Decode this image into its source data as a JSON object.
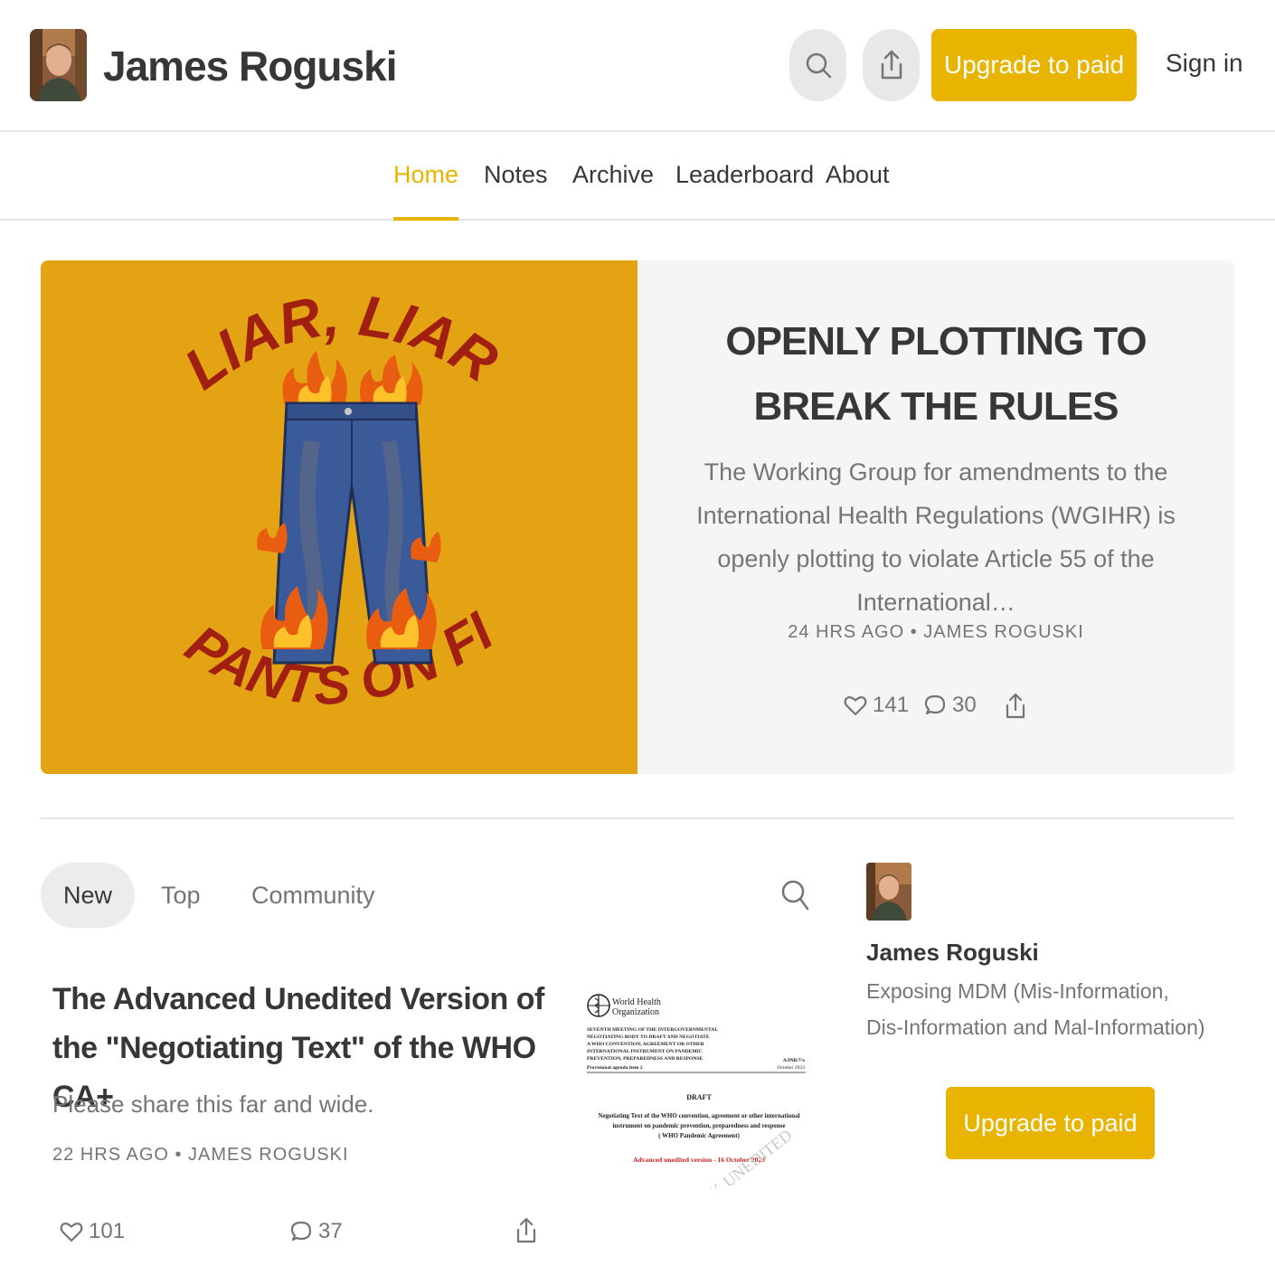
{
  "header": {
    "publication_title": "James Roguski",
    "upgrade_label": "Upgrade to paid",
    "signin_label": "Sign in",
    "search_icon": "search-icon",
    "share_icon": "share-icon"
  },
  "nav": {
    "items": [
      {
        "label": "Home",
        "active": true
      },
      {
        "label": "Notes",
        "active": false
      },
      {
        "label": "Archive",
        "active": false
      },
      {
        "label": "Leaderboard",
        "active": false
      },
      {
        "label": "About",
        "active": false
      }
    ]
  },
  "hero": {
    "image_text_top": "LIAR, LIAR,",
    "image_text_bottom": "PANTS ON FIRE",
    "title": "OPENLY PLOTTING TO BREAK THE RULES",
    "subtitle": "The Working Group for amendments to the International Health Regulations (WGIHR) is openly plotting to violate Article 55 of the International…",
    "meta": "24 HRS AGO • JAMES ROGUSKI",
    "likes": "141",
    "comments": "30"
  },
  "tabs": {
    "items": [
      {
        "label": "New",
        "active": true
      },
      {
        "label": "Top",
        "active": false
      },
      {
        "label": "Community",
        "active": false
      }
    ]
  },
  "post": {
    "title": "The Advanced Unedited Version of the \"Negotiating Text\" of the WHO CA+",
    "subtitle": "Please share this far and wide.",
    "meta": "22 HRS AGO • JAMES ROGUSKI",
    "likes": "101",
    "comments": "37",
    "thumb": {
      "org_line1": "World Health",
      "org_line2": "Organization",
      "meeting_lines": [
        "SEVENTH MEETING OF THE INTERGOVERNMENTAL",
        "NEGOTIATING BODY TO DRAFT AND NEGOTIATE",
        "A WHO CONVENTION, AGREEMENT OR OTHER",
        "INTERNATIONAL INSTRUMENT ON PANDEMIC",
        "PREVENTION, PREPAREDNESS AND RESPONSE",
        "Provisional agenda item 2"
      ],
      "doc_code": "A/INB/7/x",
      "doc_date": "October 2023",
      "draft": "DRAFT",
      "negotiating_lines": [
        "Negotiating Text of the WHO convention, agreement or other international",
        "instrument on pandemic prevention, preparedness and response",
        "( WHO Pandemic Agreement)"
      ],
      "version": "Advanced unedited version - 16 October 2023",
      "watermark": "PY, UNEDITED"
    }
  },
  "sidebar": {
    "name": "James Roguski",
    "description": "Exposing MDM (Mis-Information, Dis-Information and Mal-Information)",
    "upgrade_label": "Upgrade to paid"
  },
  "colors": {
    "accent": "#e8b400",
    "hero_image_bg": "#e4a313",
    "hero_text_red": "#a11f10",
    "text_primary": "#363737",
    "text_secondary": "#757575"
  }
}
